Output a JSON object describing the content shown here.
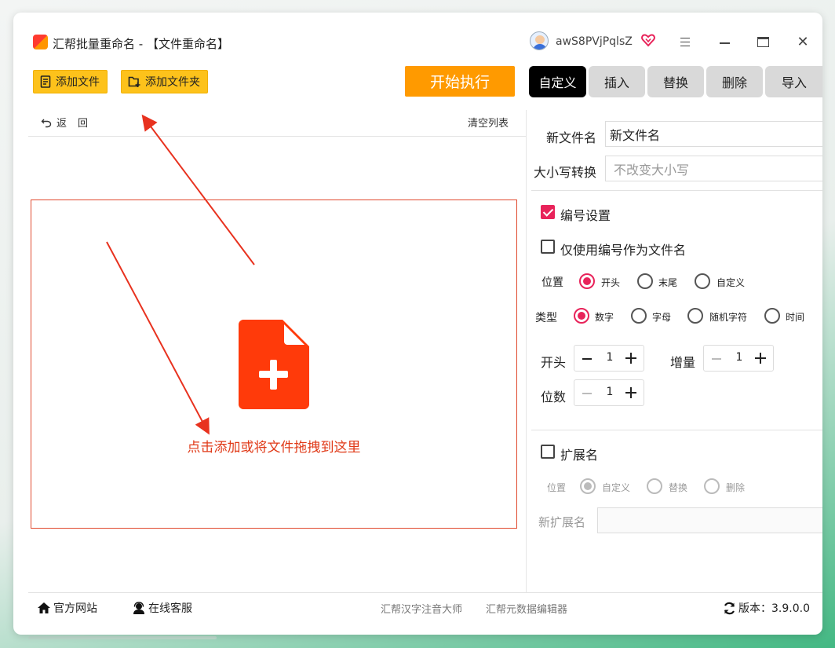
{
  "window": {
    "title": "汇帮批量重命名 - 【文件重命名】",
    "username": "awS8PVjPqlsZ"
  },
  "toolbar": {
    "add_file": "添加文件",
    "add_folder": "添加文件夹",
    "start": "开始执行"
  },
  "tabs": [
    "自定义",
    "插入",
    "替换",
    "删除",
    "导入"
  ],
  "file_panel": {
    "back": "返回",
    "clear": "清空列表",
    "drop_hint": "点击添加或将文件拖拽到这里"
  },
  "settings": {
    "new_name_label": "新文件名",
    "new_name_value": "新文件名",
    "case_label": "大小写转换",
    "case_value": "不改变大小写",
    "numbering_label": "编号设置",
    "numbering_checked": true,
    "only_number_label": "仅使用编号作为文件名",
    "only_number_checked": false,
    "position_label": "位置",
    "position_options": [
      "开头",
      "末尾",
      "自定义"
    ],
    "position_selected": "开头",
    "type_label": "类型",
    "type_options": [
      "数字",
      "字母",
      "随机字符",
      "时间"
    ],
    "type_selected": "数字",
    "start_label": "开头",
    "start_value": "1",
    "increment_label": "增量",
    "increment_value": "1",
    "digits_label": "位数",
    "digits_value": "1",
    "ext_label": "扩展名",
    "ext_checked": false,
    "ext_position_label": "位置",
    "ext_position_options": [
      "自定义",
      "替换",
      "删除"
    ],
    "ext_position_selected": "自定义",
    "new_ext_label": "新扩展名",
    "new_ext_value": ""
  },
  "footer": {
    "website": "官方网站",
    "support": "在线客服",
    "link1": "汇帮汉字注音大师",
    "link2": "汇帮元数据编辑器",
    "version": "版本：3.9.0.0"
  },
  "colors": {
    "accent_yellow": "#fdc21b",
    "start_orange": "#ff9a00",
    "checked_pink": "#e8235a",
    "drop_red": "#e03a18"
  }
}
